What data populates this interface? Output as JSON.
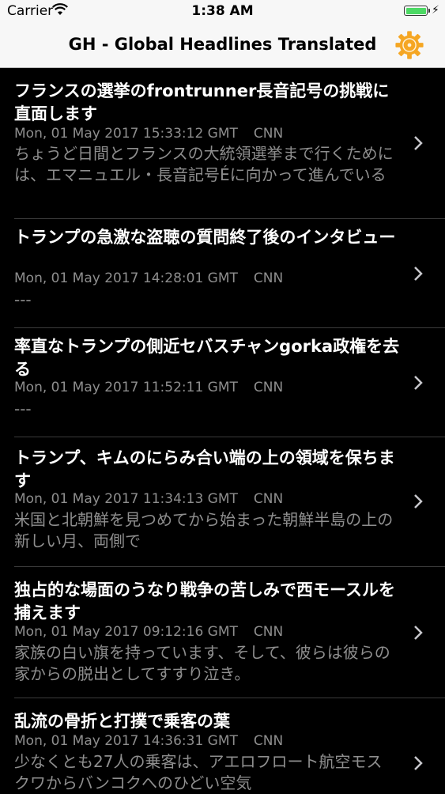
{
  "status_bar": {
    "carrier": "Carrier",
    "time": "1:38 AM",
    "battery_level": 1.0
  },
  "nav": {
    "title": "GH - Global Headlines Translated",
    "settings_icon": "gear-icon",
    "accent_color": "#f5a623"
  },
  "articles": [
    {
      "title": "フランスの選挙のfrontrunner長音記号の挑戦に直面します",
      "date": "Mon, 01 May 2017 15:33:12 GMT",
      "source": "CNN",
      "description": "ちょうど日間とフランスの大統領選挙まで行くためには、エマニュエル・長音記号Éに向かって進んでいる"
    },
    {
      "title": "トランプの急激な盗聴の質問終了後のインタビュー",
      "date": "Mon, 01 May 2017 14:28:01 GMT",
      "source": "CNN",
      "description": "---"
    },
    {
      "title": "率直なトランプの側近セバスチャンgorka政権を去る",
      "date": "Mon, 01 May 2017 11:52:11 GMT",
      "source": "CNN",
      "description": "---"
    },
    {
      "title": "トランプ、キムのにらみ合い端の上の領域を保ちます",
      "date": "Mon, 01 May 2017 11:34:13 GMT",
      "source": "CNN",
      "description": "米国と北朝鮮を見つめてから始まった朝鮮半島の上の新しい月、両側で"
    },
    {
      "title": "独占的な場面のうなり戦争の苦しみで西モースルを捕えます",
      "date": "Mon, 01 May 2017 09:12:16 GMT",
      "source": "CNN",
      "description": "家族の白い旗を持っています、そして、彼らは彼らの家からの脱出としてすすり泣き。"
    },
    {
      "title": "乱流の骨折と打撲で乗客の葉",
      "date": "Mon, 01 May 2017 14:36:31 GMT",
      "source": "CNN",
      "description": "少なくとも27人の乗客は、アエロフロート航空モスクワからバンコクへのひどい空気"
    }
  ]
}
